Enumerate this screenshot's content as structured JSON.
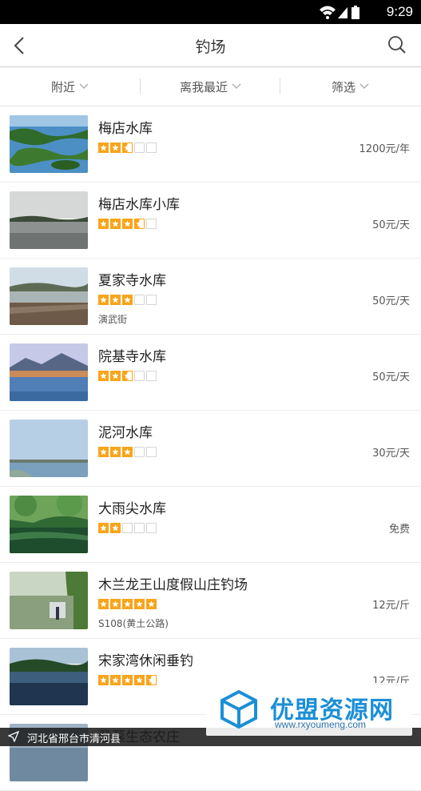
{
  "status_bar": {
    "time": "9:29"
  },
  "app_bar": {
    "title": "钓场",
    "back_icon": "back-arrow-icon",
    "search_icon": "search-icon"
  },
  "filters": [
    {
      "label": "附近"
    },
    {
      "label": "离我最近"
    },
    {
      "label": "筛选"
    }
  ],
  "spots": [
    {
      "name": "梅店水库",
      "rating": 2.5,
      "price": "1200元/年",
      "address": ""
    },
    {
      "name": "梅店水库小库",
      "rating": 3.5,
      "price": "50元/天",
      "address": ""
    },
    {
      "name": "夏家寺水库",
      "rating": 3,
      "price": "50元/天",
      "address": "演武街"
    },
    {
      "name": "院基寺水库",
      "rating": 2.5,
      "price": "50元/天",
      "address": ""
    },
    {
      "name": "泥河水库",
      "rating": 3,
      "price": "30元/天",
      "address": ""
    },
    {
      "name": "大雨尖水库",
      "rating": 2,
      "price": "免费",
      "address": ""
    },
    {
      "name": "木兰龙王山度假山庄钓场",
      "rating": 5,
      "price": "12元/斤",
      "address": "S108(黄土公路)"
    },
    {
      "name": "宋家湾休闲垂钓",
      "rating": 4.5,
      "price": "12元/斤",
      "address": ""
    },
    {
      "name": "登葆生态农庄",
      "rating": 0,
      "price": "",
      "address": ""
    }
  ],
  "location_bar": {
    "text": "河北省邢台市清河县"
  },
  "watermark": {
    "title": "优盟资源网",
    "url": "www.rxyoumeng.com"
  },
  "colors": {
    "star": "#f7a51b",
    "brand": "#1b8fd6"
  }
}
